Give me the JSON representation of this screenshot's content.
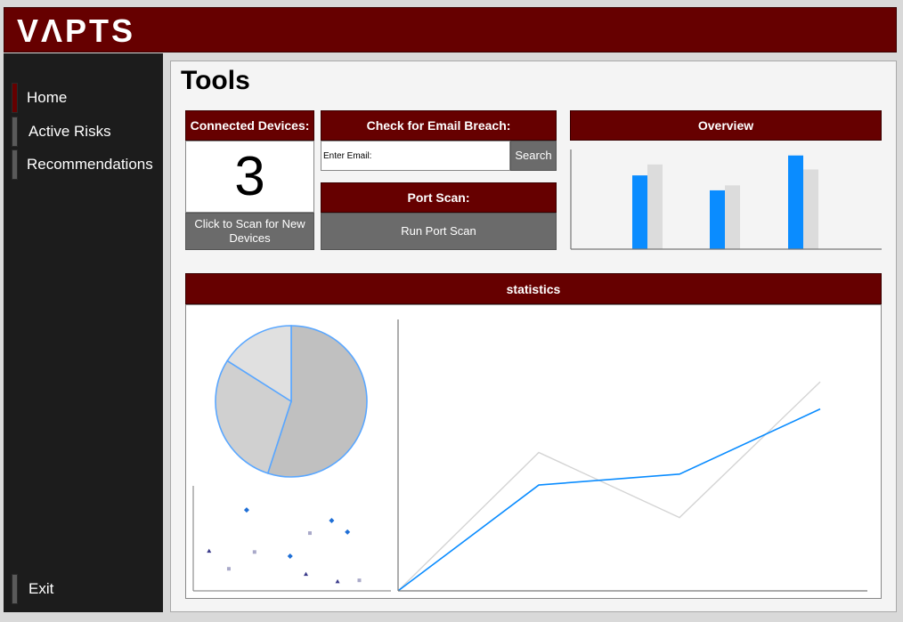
{
  "app": {
    "logo": "VΛPTS"
  },
  "sidebar": {
    "items": [
      {
        "label": "Home",
        "active": true
      },
      {
        "label": "Active Risks",
        "active": false
      },
      {
        "label": "Recommendations",
        "active": false
      }
    ],
    "exit_label": "Exit"
  },
  "main": {
    "title": "Tools",
    "connected_devices": {
      "title": "Connected Devices:",
      "count": "3",
      "scan_button": "Click to Scan for New Devices"
    },
    "email_breach": {
      "title": "Check for Email Breach:",
      "input_value": "Enter Email:",
      "search_button": "Search"
    },
    "port_scan": {
      "title": "Port Scan:",
      "run_button": "Run Port Scan"
    },
    "overview": {
      "title": "Overview"
    },
    "statistics": {
      "title": "statistics"
    }
  },
  "colors": {
    "brand": "#660000",
    "blue": "#0a8cff",
    "light_grey": "#dcdcdc",
    "sidebar": "#1c1c1c"
  },
  "chart_data": [
    {
      "type": "bar",
      "categories": [
        "",
        "",
        ""
      ],
      "series": [
        {
          "values": [
            74,
            59,
            94
          ]
        },
        {
          "values": [
            85,
            64,
            80
          ]
        }
      ],
      "ylim": [
        0,
        100
      ],
      "grid": false
    },
    {
      "type": "pie",
      "values": [
        55,
        29,
        16
      ]
    },
    {
      "type": "scatter",
      "series": [
        {
          "marker": "diamond",
          "points": [
            [
              2.7,
              7.7
            ],
            [
              4.9,
              3.3
            ],
            [
              7.0,
              6.7
            ],
            [
              7.8,
              5.6
            ]
          ]
        },
        {
          "marker": "square",
          "points": [
            [
              1.8,
              2.1
            ],
            [
              3.1,
              3.7
            ],
            [
              5.9,
              5.5
            ],
            [
              8.4,
              1.0
            ]
          ]
        },
        {
          "marker": "triangle",
          "points": [
            [
              0.8,
              3.8
            ],
            [
              5.7,
              1.6
            ],
            [
              7.3,
              0.9
            ]
          ]
        }
      ],
      "xlim": [
        0,
        10
      ],
      "ylim": [
        0,
        10
      ]
    },
    {
      "type": "line",
      "x": [
        0,
        1,
        2,
        3
      ],
      "series": [
        {
          "values": [
            0,
            39,
            43,
            67
          ]
        },
        {
          "values": [
            0,
            51,
            27,
            77
          ]
        }
      ],
      "ylim": [
        0,
        100
      ]
    }
  ]
}
